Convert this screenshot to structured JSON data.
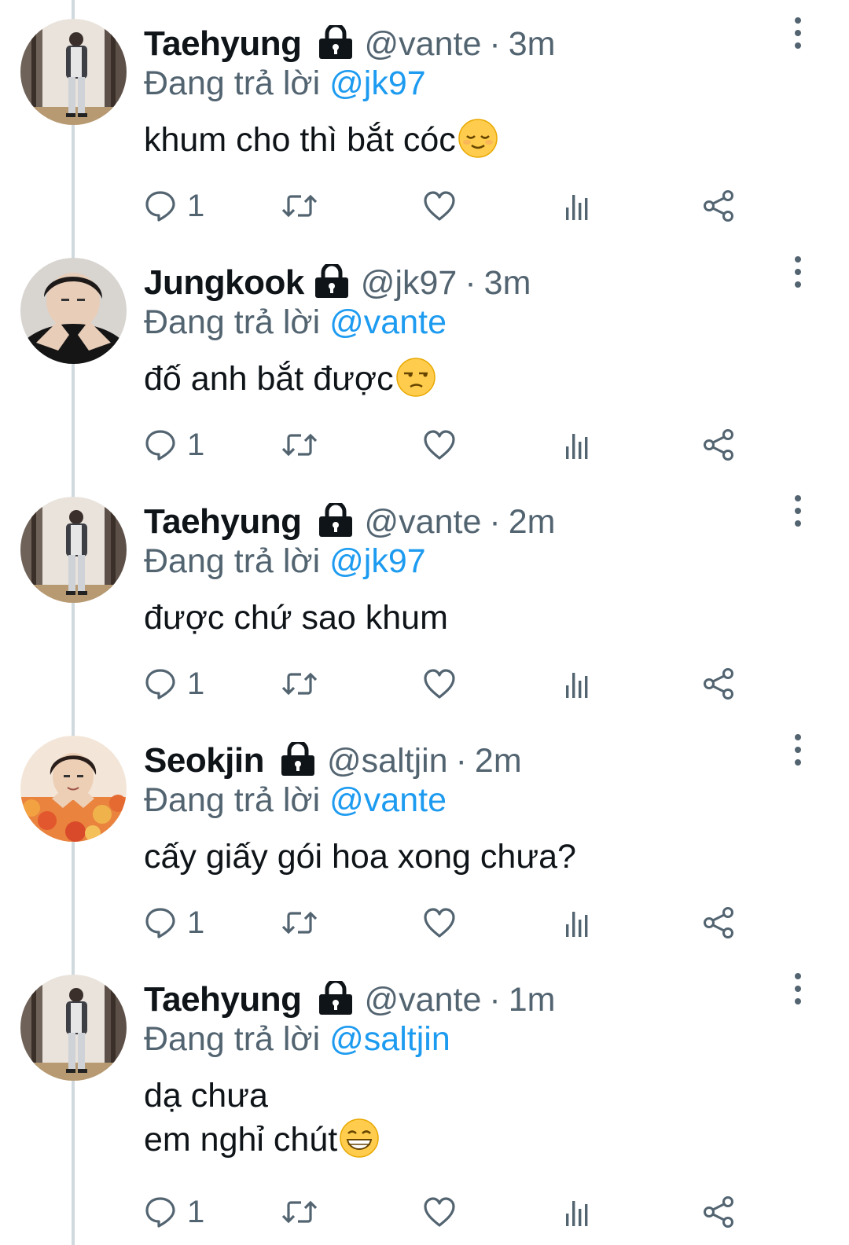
{
  "replying_prefix": "Đang trả lời",
  "tweets": [
    {
      "name": "Taehyung",
      "handle": "@vante",
      "time": "3m",
      "reply_to": "@jk97",
      "lines": [
        "khum cho thì bắt cóc"
      ],
      "emoji": "relieved-face",
      "reply_count": "1",
      "avatar": "avatar-taehyung"
    },
    {
      "name": "Jungkook",
      "handle": "@jk97",
      "time": "3m",
      "reply_to": "@vante",
      "lines": [
        "đố anh bắt được"
      ],
      "emoji": "unamused-face",
      "reply_count": "1",
      "avatar": "avatar-jungkook"
    },
    {
      "name": "Taehyung",
      "handle": "@vante",
      "time": "2m",
      "reply_to": "@jk97",
      "lines": [
        "được chứ sao khum"
      ],
      "emoji": "",
      "reply_count": "1",
      "avatar": "avatar-taehyung"
    },
    {
      "name": "Seokjin",
      "handle": "@saltjin",
      "time": "2m",
      "reply_to": "@vante",
      "lines": [
        "cấy giấy gói hoa xong chưa?"
      ],
      "emoji": "",
      "reply_count": "1",
      "avatar": "avatar-seokjin"
    },
    {
      "name": "Taehyung",
      "handle": "@vante",
      "time": "1m",
      "reply_to": "@saltjin",
      "lines": [
        "dạ chưa",
        "em nghỉ chút"
      ],
      "emoji": "grinning-face",
      "reply_count": "1",
      "avatar": "avatar-taehyung"
    }
  ],
  "colors": {
    "name": "#0f1419",
    "secondary": "#536471",
    "mention": "#1d9bf0",
    "thread_line": "#cfd9de"
  },
  "icons": [
    "lock-icon",
    "more-icon",
    "reply-icon",
    "retweet-icon",
    "like-icon",
    "views-icon",
    "share-icon"
  ]
}
